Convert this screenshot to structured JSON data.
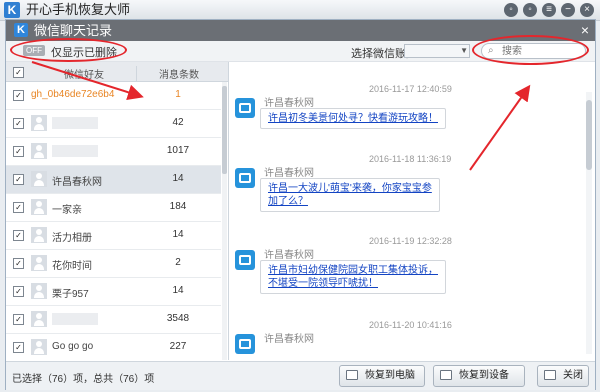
{
  "app": {
    "title": "开心手机恢复大师",
    "logo_letter": "K"
  },
  "dialog": {
    "title": "微信聊天记录",
    "logo_letter": "K",
    "close_glyph": "×"
  },
  "filter": {
    "toggle_text": "OFF",
    "label": "仅显示已删除",
    "account_label": "选择微信账户",
    "account_value": "",
    "search_placeholder": "搜索"
  },
  "list": {
    "headers": {
      "friend": "微信好友",
      "count": "消息条数"
    },
    "rows": [
      {
        "name": "gh_0b46de72e6b4",
        "count": "1",
        "checked": true,
        "blurred": false
      },
      {
        "name": "",
        "count": "42",
        "checked": true,
        "blurred": true
      },
      {
        "name": "",
        "count": "1017",
        "checked": true,
        "blurred": true
      },
      {
        "name": "许昌春秋网",
        "count": "14",
        "checked": true,
        "blurred": false
      },
      {
        "name": "一家亲",
        "count": "184",
        "checked": true,
        "blurred": false
      },
      {
        "name": "活力相册",
        "count": "14",
        "checked": true,
        "blurred": false
      },
      {
        "name": "花你时间",
        "count": "2",
        "checked": true,
        "blurred": false
      },
      {
        "name": "栗子957",
        "count": "14",
        "checked": true,
        "blurred": false
      },
      {
        "name": "",
        "count": "3548",
        "checked": true,
        "blurred": true
      },
      {
        "name": "Go go go",
        "count": "227",
        "checked": true,
        "blurred": false
      }
    ]
  },
  "messages": [
    {
      "time": "2016-11-17 12:40:59",
      "sender": "许昌春秋网",
      "lines": [
        "许昌初冬美景何处寻？快看游玩攻略！"
      ]
    },
    {
      "time": "2016-11-18 11:36:19",
      "sender": "许昌春秋网",
      "lines": [
        "许昌一大波儿'萌宝'来袭，你家宝宝参",
        "加了么？"
      ]
    },
    {
      "time": "2016-11-19 12:32:28",
      "sender": "许昌春秋网",
      "lines": [
        "许昌市妇幼保健院园女职工集体投诉，",
        "不堪受一院领导吓唬扰！"
      ]
    },
    {
      "time": "2016-11-20 10:41:16",
      "sender": "许昌春秋网",
      "lines": []
    }
  ],
  "status": {
    "text": "已选择（76）项，总共（76）项"
  },
  "buttons": {
    "restore_pc": "恢复到电脑",
    "restore_device": "恢复到设备",
    "close": "关闭"
  },
  "colors": {
    "accent_orange": "#e88524",
    "link_blue": "#1344c3",
    "header_gray": "#6b6f75",
    "annotation_red": "#e4262c"
  }
}
